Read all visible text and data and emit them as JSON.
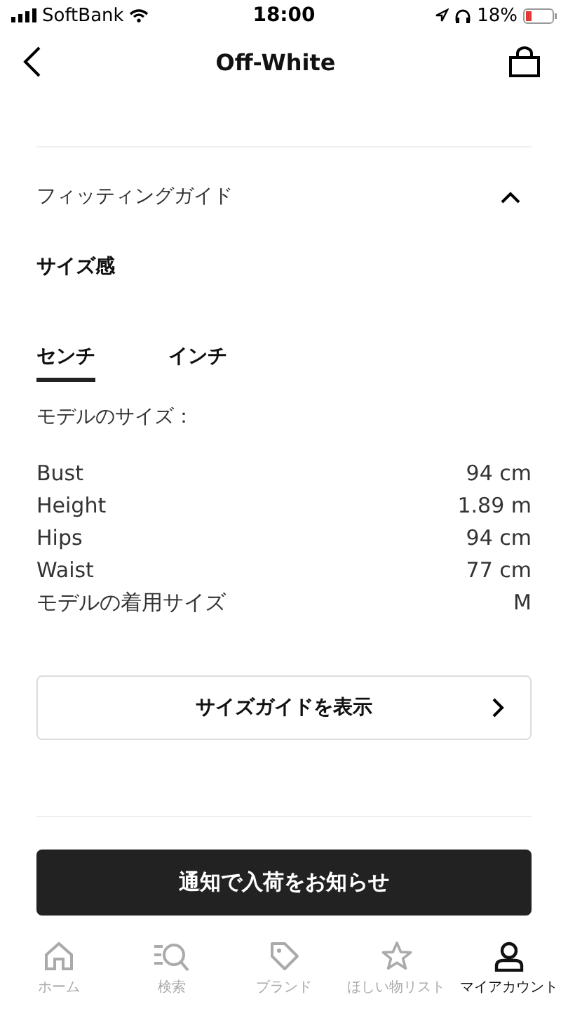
{
  "status_bar": {
    "carrier": "SoftBank",
    "time": "18:00",
    "battery": "18%"
  },
  "nav": {
    "title": "Off-White"
  },
  "accordion": {
    "title": "フィッティングガイド",
    "expanded": true
  },
  "section_title": "サイズ感",
  "unit_tabs": [
    {
      "label": "センチ",
      "selected": true
    },
    {
      "label": "インチ",
      "selected": false
    }
  ],
  "model_heading": "モデルのサイズ：",
  "measurements": [
    {
      "label": "Bust",
      "value": "94 cm"
    },
    {
      "label": "Height",
      "value": "1.89 m"
    },
    {
      "label": "Hips",
      "value": "94 cm"
    },
    {
      "label": "Waist",
      "value": "77 cm"
    },
    {
      "label": "モデルの着用サイズ",
      "value": "M"
    }
  ],
  "size_guide_button": "サイズガイドを表示",
  "notify_button": "通知で入荷をお知らせ",
  "tab_bar": [
    {
      "kind": "home",
      "label": "ホーム",
      "selected": false
    },
    {
      "kind": "search",
      "label": "検索",
      "selected": false
    },
    {
      "kind": "brand",
      "label": "ブランド",
      "selected": false
    },
    {
      "kind": "wishlist",
      "label": "ほしい物リスト",
      "selected": false
    },
    {
      "kind": "account",
      "label": "マイアカウント",
      "selected": true
    }
  ]
}
